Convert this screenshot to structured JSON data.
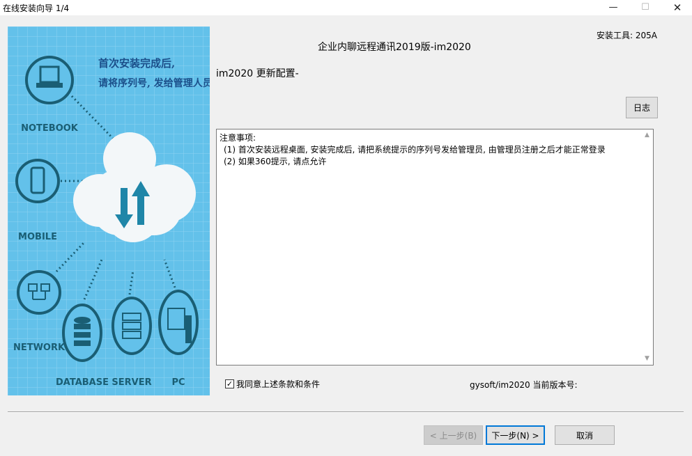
{
  "window": {
    "title": "在线安装向导 1/4",
    "controls": {
      "minimize": "—",
      "maximize": "☐",
      "close": "✕"
    }
  },
  "banner": {
    "caption_line1": "首次安装完成后,",
    "caption_line2": "请将序列号, 发给管理人员注册",
    "nodes": [
      "NOTEBOOK",
      "MOBILE",
      "NETWORK",
      "DATABASE",
      "SERVER",
      "PC"
    ],
    "colors": {
      "background": "#63c1ea",
      "circle": "#1a5e74",
      "caption": "#1b4f8a",
      "cloud": "#f3f7f9",
      "arrow": "#1f86a8"
    }
  },
  "header": {
    "tool_label": "安装工具: 205A",
    "app_title": "企业内聊远程通讯2019版-im2020",
    "config_label": "im2020 更新配置-"
  },
  "buttons": {
    "log": "日志",
    "back": "< 上一步(B)",
    "next": "下一步(N) >",
    "cancel": "取消"
  },
  "notes": {
    "heading": "注意事项:",
    "lines": [
      "(1) 首次安装远程桌面, 安装完成后, 请把系统提示的序列号发给管理员, 由管理员注册之后才能正常登录",
      "(2) 如果360提示, 请点允许"
    ]
  },
  "agreement": {
    "label": "我同意上述条款和条件",
    "checked": true,
    "check_glyph": "✓"
  },
  "version": {
    "label": "gysoft/im2020 当前版本号:"
  },
  "colors": {
    "accent": "#0078d7",
    "window_bg": "#f0f0f0"
  }
}
